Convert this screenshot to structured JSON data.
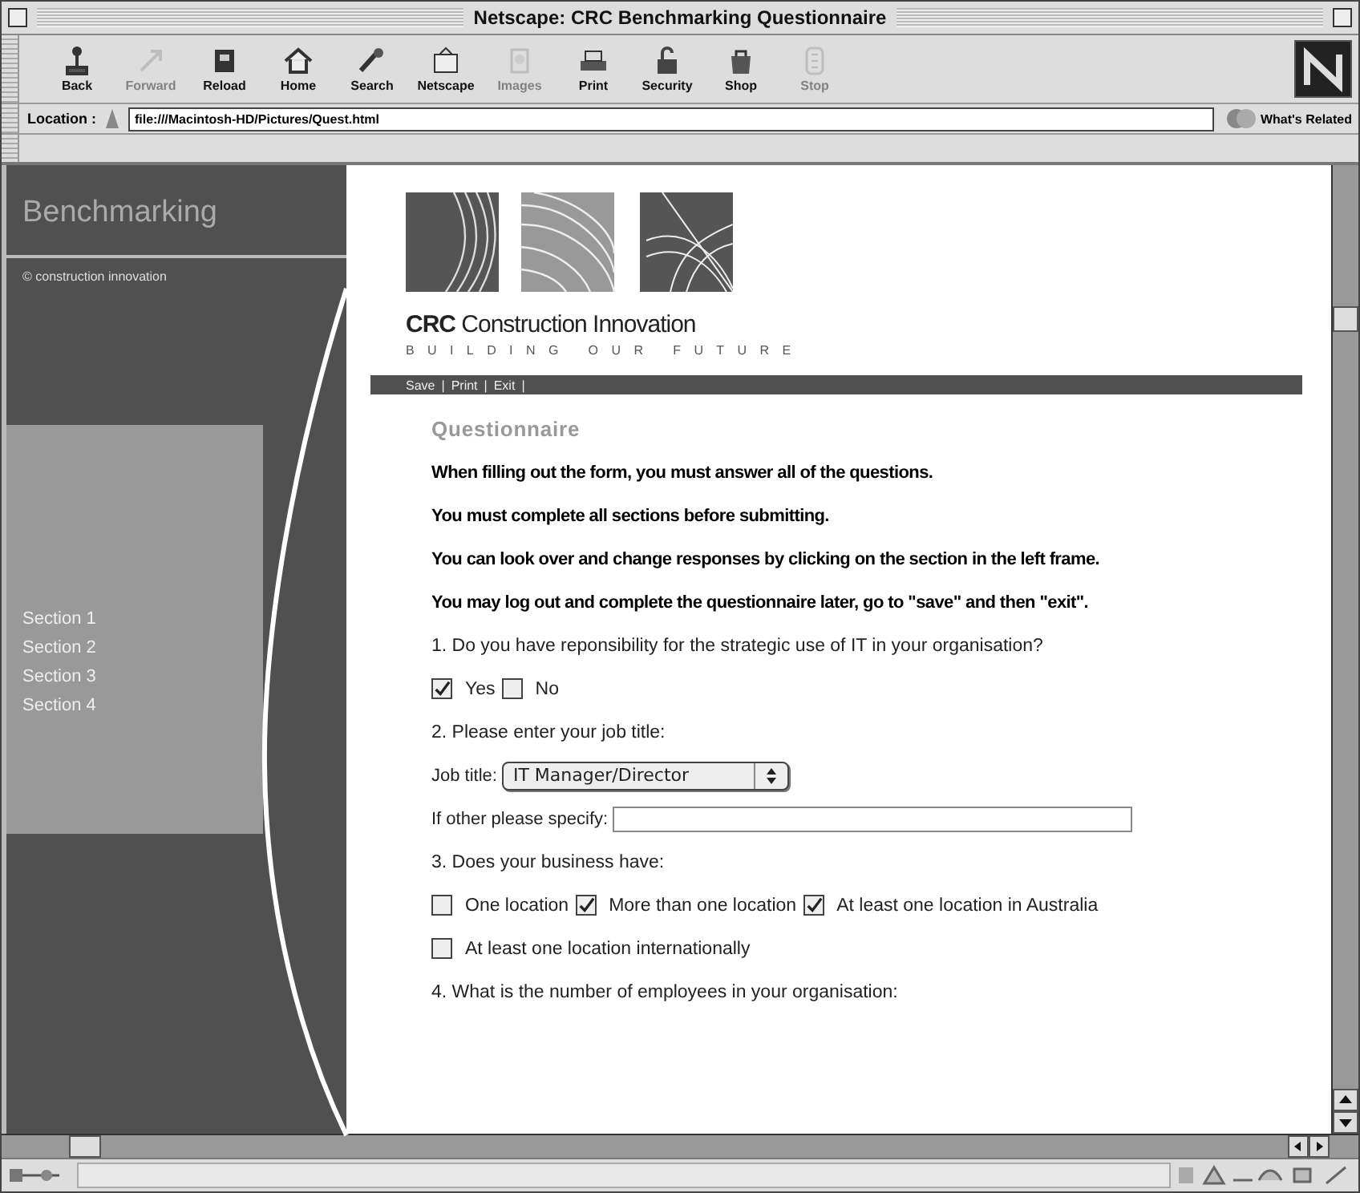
{
  "window": {
    "title": "Netscape: CRC Benchmarking Questionnaire"
  },
  "toolbar": {
    "buttons": [
      {
        "label": "Back",
        "disabled": false
      },
      {
        "label": "Forward",
        "disabled": true
      },
      {
        "label": "Reload",
        "disabled": false
      },
      {
        "label": "Home",
        "disabled": false
      },
      {
        "label": "Search",
        "disabled": false
      },
      {
        "label": "Netscape",
        "disabled": false
      },
      {
        "label": "Images",
        "disabled": true
      },
      {
        "label": "Print",
        "disabled": false
      },
      {
        "label": "Security",
        "disabled": false
      },
      {
        "label": "Shop",
        "disabled": false
      },
      {
        "label": "Stop",
        "disabled": true
      }
    ]
  },
  "location": {
    "label": "Location :",
    "value": "file:///Macintosh-HD/Pictures/Quest.html",
    "related": "What's Related"
  },
  "sidebar": {
    "title": "Benchmarking",
    "copyright": "© construction innovation",
    "items": [
      {
        "label": "Section 1"
      },
      {
        "label": "Section 2"
      },
      {
        "label": "Section 3"
      },
      {
        "label": "Section 4"
      }
    ]
  },
  "page": {
    "logo": {
      "name": "**CRC** Construction Innovation",
      "tagline": "BUILDING OUR FUTURE"
    },
    "nav_links": [
      {
        "label": "Save",
        "separator": "|"
      },
      {
        "label": "Print",
        "separator": "|"
      },
      {
        "label": "Exit",
        "separator": "|"
      }
    ],
    "heading": "Questionnaire",
    "instructions": [
      "When filling out the form, you must answer all of the questions.",
      "You must complete all sections before submitting.",
      "You can look over and change responses by clicking on the section in the left frame.",
      "You may log out and complete the questionnaire later, go to \"save\" and then \"exit\"."
    ],
    "form": [
      {
        "kind": "question",
        "text": "1. Do you have reponsibility for the strategic use of IT in your organisation?"
      },
      {
        "kind": "checkboxes",
        "options": [
          {
            "label": "Yes",
            "checked": true
          },
          {
            "label": "No",
            "checked": false
          }
        ]
      },
      {
        "kind": "question",
        "text": "2. Please enter your job title:"
      },
      {
        "kind": "select",
        "label": "Job title:",
        "value": "IT Manager/Director"
      },
      {
        "kind": "text_field",
        "label": "If other please specify:"
      },
      {
        "kind": "question",
        "text": "3. Does your business have:"
      },
      {
        "kind": "checkboxes",
        "options": [
          {
            "label": "One location",
            "checked": false
          },
          {
            "label": "More than one location",
            "checked": true
          },
          {
            "label": "At least one location in Australia",
            "checked": true
          }
        ]
      },
      {
        "kind": "checkboxes",
        "options": [
          {
            "label": "At least one location internationally",
            "checked": false
          }
        ]
      },
      {
        "kind": "question",
        "text": "4. What is the number of employees in your organisation:"
      }
    ]
  }
}
